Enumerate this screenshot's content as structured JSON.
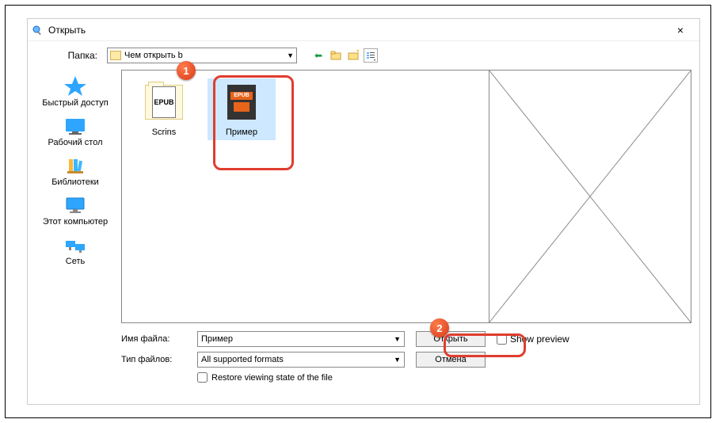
{
  "window": {
    "title": "Открыть",
    "close_icon": "×"
  },
  "top": {
    "folder_label": "Папка:",
    "folder_value": "Чем открыть        b",
    "nav_back": "⇦",
    "nav_up": "📁",
    "nav_new": "📂",
    "nav_view": "☰"
  },
  "places": [
    {
      "icon": "star",
      "label": "Быстрый доступ"
    },
    {
      "icon": "desktop",
      "label": "Рабочий стол"
    },
    {
      "icon": "libraries",
      "label": "Библиотеки"
    },
    {
      "icon": "computer",
      "label": "Этот компьютер"
    },
    {
      "icon": "network",
      "label": "Сеть"
    }
  ],
  "files": [
    {
      "name": "Scrins",
      "type": "folder",
      "badge_text": "EPUB"
    },
    {
      "name": "Пример",
      "type": "epub",
      "badge_text": "EPUB",
      "selected": true
    }
  ],
  "form": {
    "filename_label": "Имя файла:",
    "filename_value": "Пример",
    "filetype_label": "Тип файлов:",
    "filetype_value": "All supported formats",
    "restore_label": "Restore viewing state of the file",
    "open_button": "Открыть",
    "cancel_button": "Отмена",
    "show_preview": "Show preview"
  },
  "callouts": {
    "badge1": "1",
    "badge2": "2"
  }
}
